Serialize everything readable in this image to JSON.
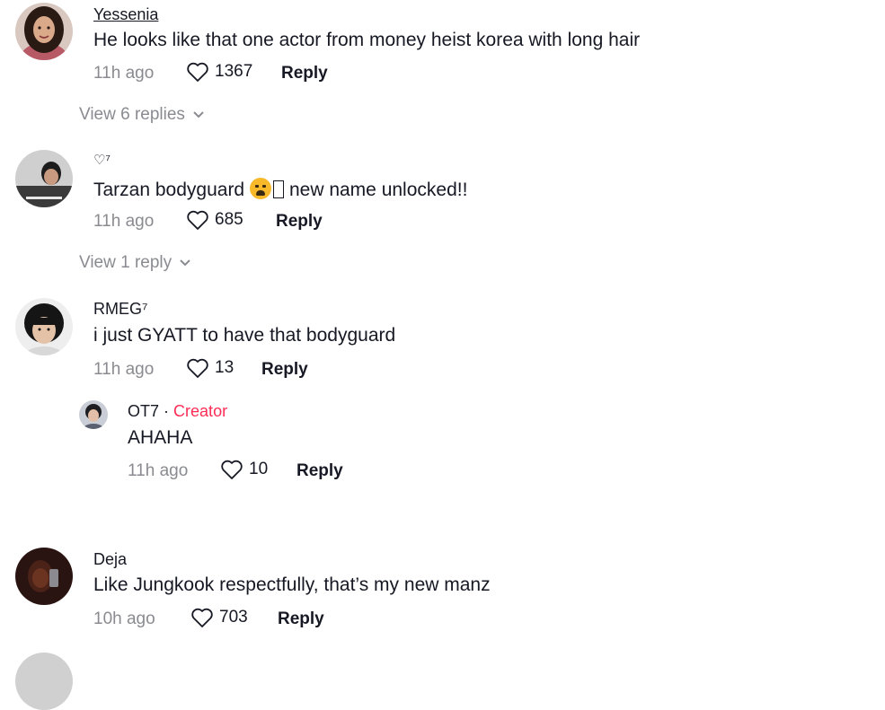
{
  "comments": [
    {
      "username": "Yessenia",
      "text": "He looks like that one actor from money heist korea with long hair",
      "time": "11h ago",
      "likes": "1367",
      "reply_label": "Reply",
      "view_replies": "View 6 replies"
    },
    {
      "username": "♡⁷",
      "text_before": "Tarzan bodyguard",
      "text_after": "new name unlocked!!",
      "time": "11h ago",
      "likes": "685",
      "reply_label": "Reply",
      "view_replies": "View 1 reply"
    },
    {
      "username": "RMEG⁷",
      "text": "i just GYATT to have that bodyguard",
      "time": "11h ago",
      "likes": "13",
      "reply_label": "Reply",
      "replies": [
        {
          "username": "OT7",
          "separator": "·",
          "badge": "Creator",
          "text": "AHAHA",
          "time": "11h ago",
          "likes": "10",
          "reply_label": "Reply"
        }
      ]
    },
    {
      "username": "Deja",
      "text": "Like Jungkook respectfully, that’s my new manz",
      "time": "10h ago",
      "likes": "703",
      "reply_label": "Reply"
    }
  ],
  "icons": {
    "like": "heart-outline-icon",
    "expand": "chevron-down-icon"
  },
  "colors": {
    "creator_badge": "#fe2c55",
    "meta_gray": "#8a8b91",
    "text": "#161823"
  }
}
